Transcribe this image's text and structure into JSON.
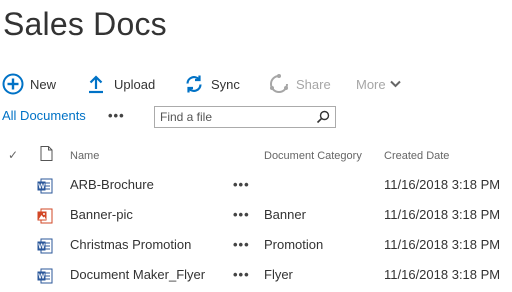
{
  "library": {
    "title": "Sales Docs"
  },
  "commands": {
    "new_label": "New",
    "upload_label": "Upload",
    "sync_label": "Sync",
    "share_label": "Share",
    "more_label": "More"
  },
  "view": {
    "current_view": "All Documents",
    "options_label": "•••",
    "search_placeholder": "Find a file"
  },
  "columns": {
    "select": "✓",
    "name": "Name",
    "category": "Document Category",
    "created": "Created Date"
  },
  "documents": [
    {
      "name": "ARB-Brochure",
      "icon": "word-doc-icon",
      "menu": "•••",
      "category": "",
      "created": "11/16/2018 3:18 PM"
    },
    {
      "name": "Banner-pic",
      "icon": "image-file-icon",
      "menu": "•••",
      "category": "Banner",
      "created": "11/16/2018 3:18 PM"
    },
    {
      "name": "Christmas Promotion",
      "icon": "word-doc-icon",
      "menu": "•••",
      "category": "Promotion",
      "created": "11/16/2018 3:18 PM"
    },
    {
      "name": "Document Maker_Flyer",
      "icon": "word-doc-icon",
      "menu": "•••",
      "category": "Flyer",
      "created": "11/16/2018 3:18 PM"
    }
  ],
  "colors": {
    "accent": "#0072c6",
    "text": "#333333",
    "disabled": "#a6a6a6",
    "word_blue": "#2b579a",
    "image_orange": "#d24726"
  }
}
